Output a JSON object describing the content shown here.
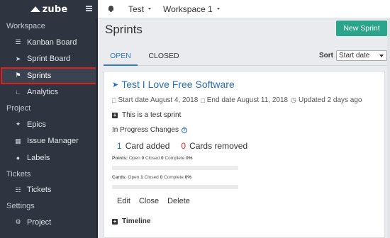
{
  "app": {
    "logo_text": "zube"
  },
  "sidebar": {
    "sections": [
      {
        "title": "Workspace",
        "items": [
          {
            "label": "Kanban Board",
            "icon": "kanban-icon"
          },
          {
            "label": "Sprint Board",
            "icon": "rocket-icon"
          },
          {
            "label": "Sprints",
            "icon": "flag-icon",
            "active": true
          },
          {
            "label": "Analytics",
            "icon": "chart-icon"
          }
        ]
      },
      {
        "title": "Project",
        "items": [
          {
            "label": "Epics",
            "icon": "epics-icon"
          },
          {
            "label": "Issue Manager",
            "icon": "list-icon"
          },
          {
            "label": "Labels",
            "icon": "tag-icon"
          }
        ]
      },
      {
        "title": "Tickets",
        "items": [
          {
            "label": "Tickets",
            "icon": "ticket-icon"
          }
        ]
      },
      {
        "title": "Settings",
        "items": [
          {
            "label": "Project",
            "icon": "gear-icon"
          }
        ]
      }
    ]
  },
  "topbar": {
    "project": "Test",
    "workspace": "Workspace 1"
  },
  "page": {
    "title": "Sprints",
    "new_button": "New Sprint"
  },
  "tabs": {
    "open": "OPEN",
    "closed": "CLOSED"
  },
  "sort": {
    "label": "Sort",
    "value": "Start date"
  },
  "sprint": {
    "title": "Test I Love Free Software",
    "start": "Start date August 4, 2018",
    "end": "End date August 11, 2018",
    "updated": "Updated 2 days ago",
    "description": "This is a test sprint",
    "in_progress_label": "In Progress Changes",
    "added_count": "1",
    "added_label": "Card added",
    "removed_count": "0",
    "removed_label": "Cards removed",
    "points": {
      "label": "Points:",
      "open_label": "Open",
      "open": "0",
      "closed_label": "Closed",
      "closed": "0",
      "complete_label": "Complete",
      "complete": "0%",
      "progress": 0
    },
    "cards": {
      "label": "Cards:",
      "open_label": "Open",
      "open": "1",
      "closed_label": "Closed",
      "closed": "0",
      "complete_label": "Complete",
      "complete": "0%",
      "progress": 0
    },
    "actions": {
      "edit": "Edit",
      "close": "Close",
      "delete": "Delete"
    },
    "timeline": "Timeline"
  },
  "colors": {
    "sidebar_bg": "#2f3540",
    "accent": "#2aa48b",
    "link": "#2a6fb6",
    "removed": "#d9302c",
    "highlight": "#e02020"
  }
}
